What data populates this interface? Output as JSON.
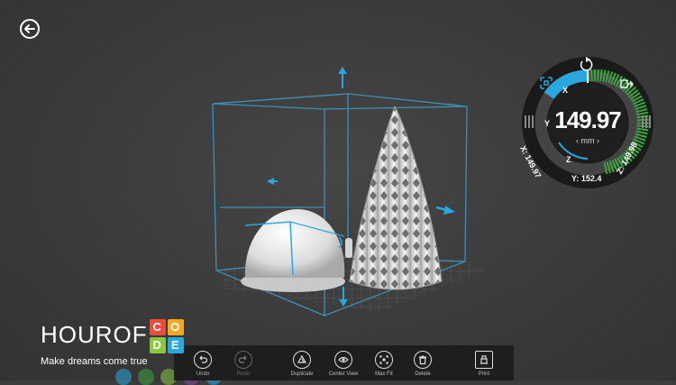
{
  "viewport": {
    "back_button_label": "Back",
    "icons": {
      "back": "arrow-left-icon",
      "move_up": "arrow-up-icon",
      "move_down": "arrow-down-icon",
      "move_left": "arrow-left-icon",
      "move_right": "arrow-right-icon"
    }
  },
  "scale_widget": {
    "value": "149.97",
    "unit": "mm",
    "axis_labels": {
      "x_tag": "X",
      "y_tag": "Y",
      "z_tag": "Z"
    },
    "x_readout": "X: 149.97",
    "y_readout": "Y: 152.4",
    "z_readout": "Z: 149.98",
    "colors": {
      "accent": "#29a8e0",
      "green": "#3da540",
      "ring": "#1a1a1a"
    },
    "icons": {
      "reset": "rotate-icon",
      "fit": "fit-frame-icon",
      "lock": "uniform-scale-icon"
    }
  },
  "brand": {
    "hour_of": "HOUROF",
    "code_letters": [
      "C",
      "O",
      "D",
      "E"
    ],
    "code_colors": [
      "#e94e3c",
      "#f7a823",
      "#8dc63f",
      "#29a8e0"
    ],
    "tagline": "Make dreams come true"
  },
  "toolbar": {
    "items": [
      {
        "label": "Undo",
        "icon": "undo-icon",
        "enabled": true
      },
      {
        "label": "Redo",
        "icon": "redo-icon",
        "enabled": false
      },
      {
        "label": "Duplicate",
        "icon": "duplicate-icon",
        "enabled": true
      },
      {
        "label": "Center View",
        "icon": "eye-icon",
        "enabled": true
      },
      {
        "label": "Max Fit",
        "icon": "max-fit-icon",
        "enabled": true
      },
      {
        "label": "Delete",
        "icon": "trash-icon",
        "enabled": true
      },
      {
        "label": "Print",
        "icon": "printer-icon",
        "enabled": true
      }
    ]
  }
}
